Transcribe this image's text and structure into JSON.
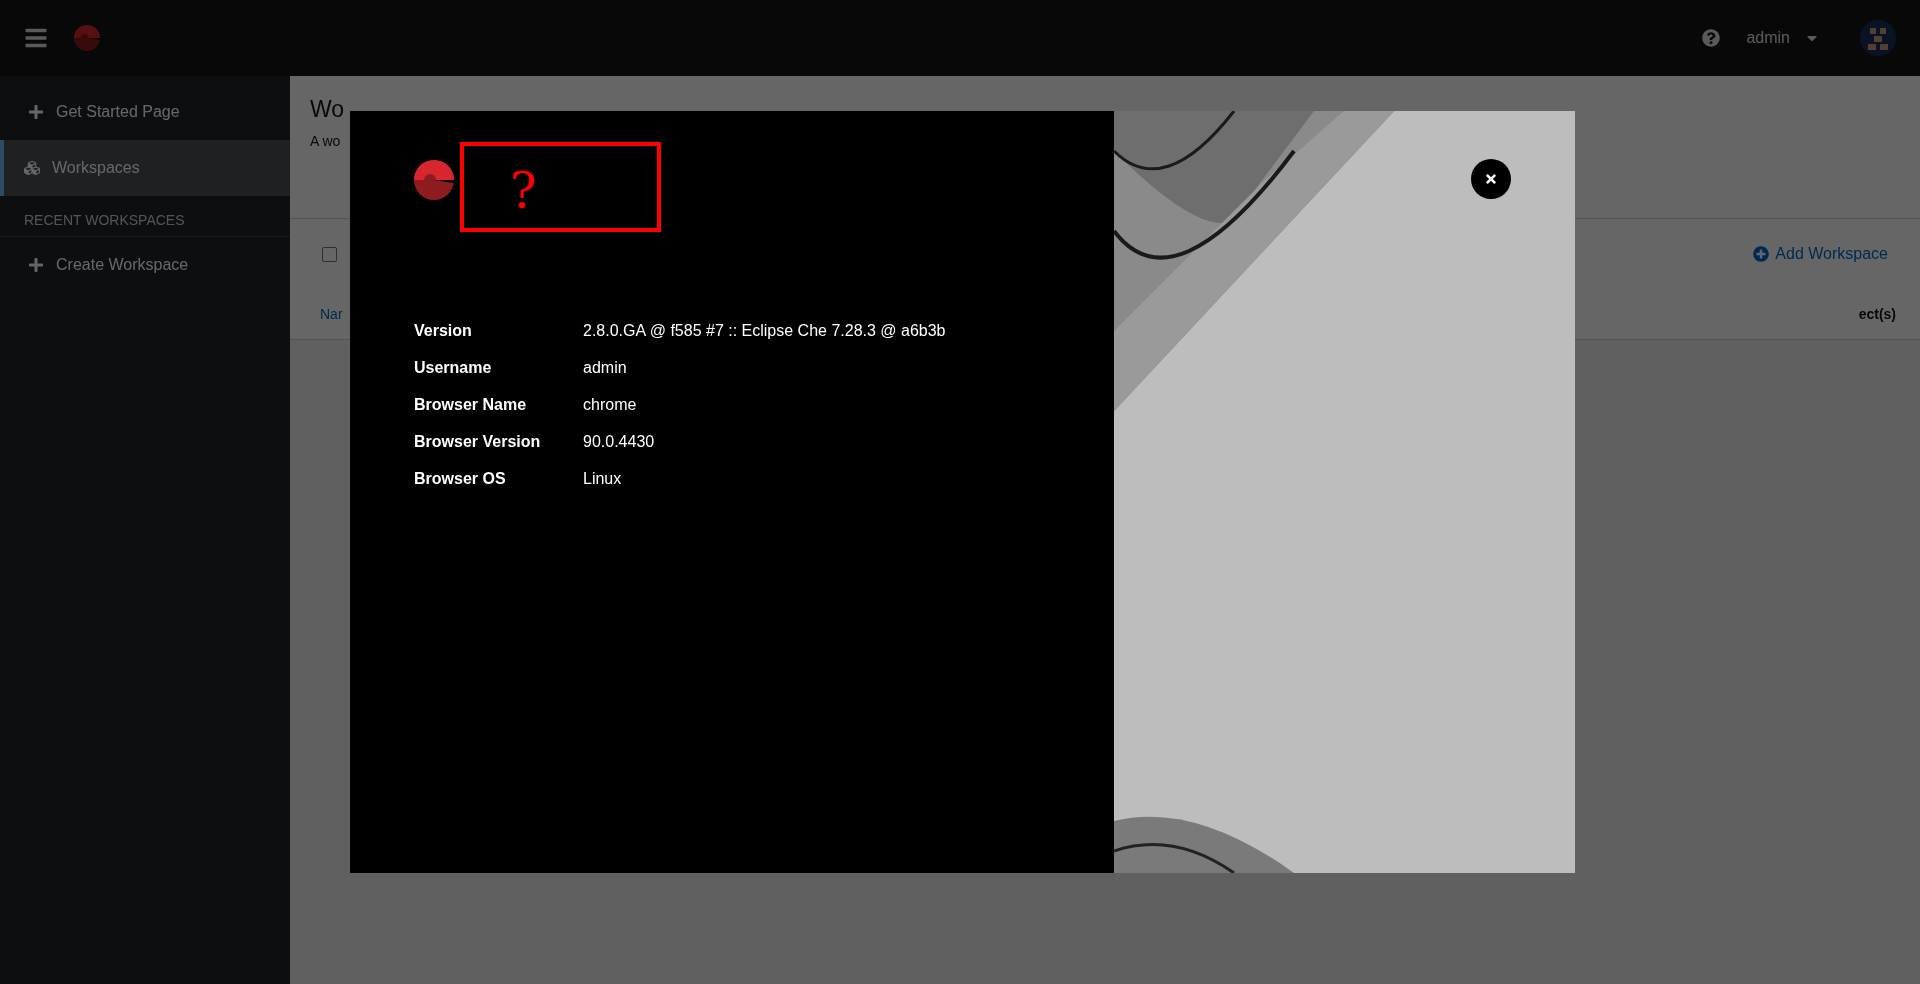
{
  "top_bar": {
    "user": "admin"
  },
  "sidebar": {
    "items": [
      {
        "label": "Get Started Page",
        "selected": false,
        "kind": "plus"
      },
      {
        "label": "Workspaces",
        "selected": true,
        "kind": "workspaces"
      }
    ],
    "section": "RECENT WORKSPACES",
    "section_items": [
      {
        "label": "Create Workspace",
        "selected": false,
        "kind": "plus"
      }
    ]
  },
  "page": {
    "title": "Wo",
    "subtitle": "A wo",
    "select_all": {
      "checked": false
    },
    "add_button": "Add Workspace",
    "columns": [
      "Nar",
      "ect(s)"
    ]
  },
  "about": {
    "annotation": "?",
    "rows": [
      {
        "label": "Version",
        "value": "2.8.0.GA @ f585 #7 :: Eclipse Che 7.28.3 @ a6b3b"
      },
      {
        "label": "Username",
        "value": "admin"
      },
      {
        "label": "Browser Name",
        "value": "chrome"
      },
      {
        "label": "Browser Version",
        "value": "90.0.4430"
      },
      {
        "label": "Browser OS",
        "value": "Linux"
      }
    ]
  }
}
